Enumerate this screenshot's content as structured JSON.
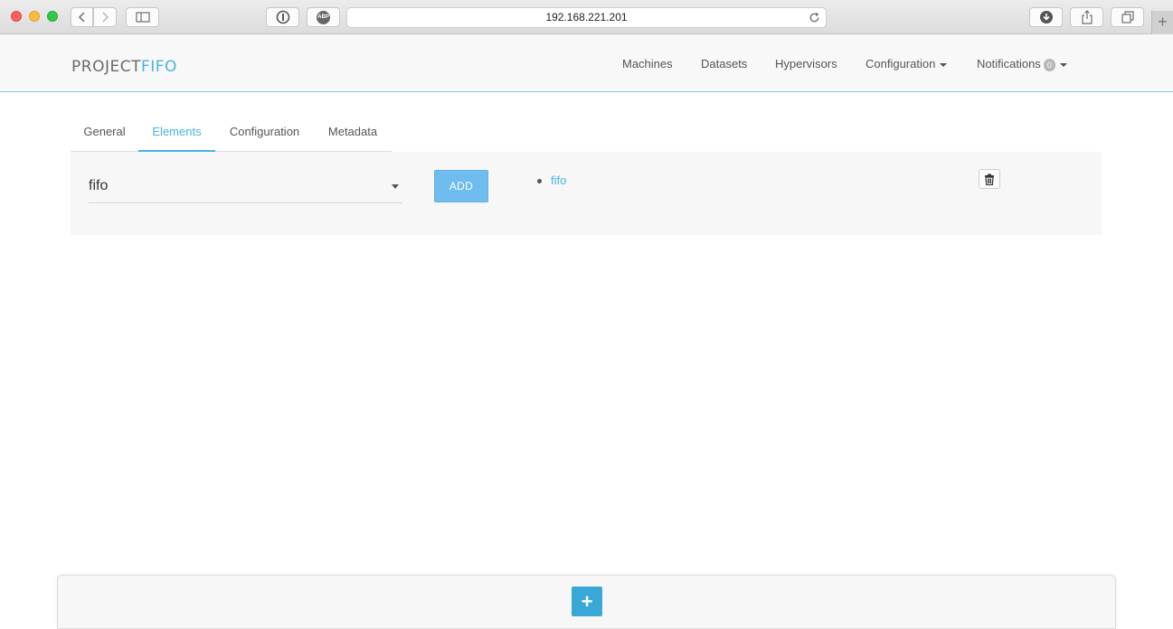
{
  "browser": {
    "url": "192.168.221.201",
    "abp_label": "ABP",
    "new_tab_glyph": "+"
  },
  "navbar": {
    "logo_part1": "PROJECT",
    "logo_part2": "FIFO",
    "items": [
      {
        "label": "Machines"
      },
      {
        "label": "Datasets"
      },
      {
        "label": "Hypervisors"
      },
      {
        "label": "Configuration",
        "dropdown": true
      },
      {
        "label": "Notifications",
        "dropdown": true
      }
    ],
    "notifications_count": "0"
  },
  "tabs": [
    {
      "label": "General",
      "active": false
    },
    {
      "label": "Elements",
      "active": true
    },
    {
      "label": "Configuration",
      "active": false
    },
    {
      "label": "Metadata",
      "active": false
    }
  ],
  "elements_panel": {
    "select_value": "fifo",
    "add_label": "ADD",
    "elements": [
      "fifo"
    ]
  },
  "footer": {
    "plus_glyph": "+"
  },
  "colors": {
    "accent": "#49b3e2",
    "add_button": "#6fbdee",
    "plus_button": "#3aa8d6"
  }
}
